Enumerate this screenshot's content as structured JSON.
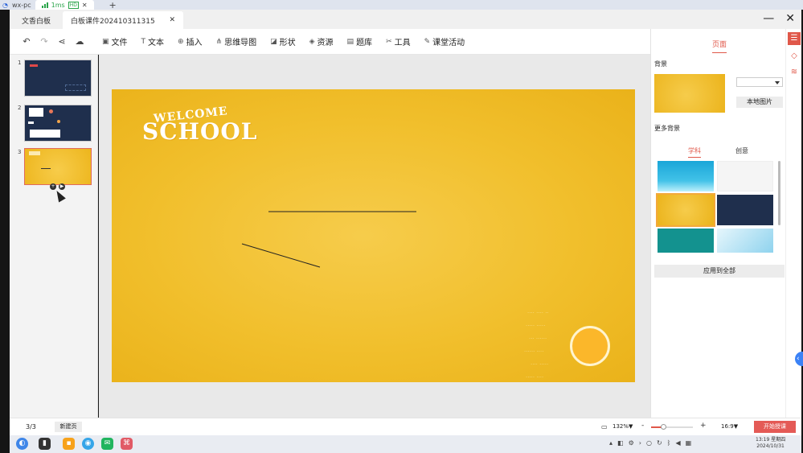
{
  "remote": {
    "device": "wx-pc",
    "latency": "1ms",
    "quality": "HD"
  },
  "app_tabs": [
    {
      "label": "文香白板",
      "active": false
    },
    {
      "label": "白板课件202410311315",
      "active": true
    }
  ],
  "toolbar": {
    "items": [
      {
        "label": "文件",
        "icon": "file-icon"
      },
      {
        "label": "文本",
        "icon": "text-icon"
      },
      {
        "label": "插入",
        "icon": "insert-icon"
      },
      {
        "label": "思维导图",
        "icon": "mindmap-icon"
      },
      {
        "label": "形状",
        "icon": "shape-icon"
      },
      {
        "label": "资源",
        "icon": "resource-icon"
      },
      {
        "label": "题库",
        "icon": "question-bank-icon"
      },
      {
        "label": "工具",
        "icon": "tools-icon"
      },
      {
        "label": "课堂活动",
        "icon": "class-activity-icon"
      }
    ]
  },
  "thumbnails": [
    {
      "num": "1"
    },
    {
      "num": "2"
    },
    {
      "num": "3"
    }
  ],
  "slide": {
    "welcome": "WELCOME",
    "school": "SCHOOL"
  },
  "right_panel": {
    "tab": "页面",
    "background_label": "背景",
    "local_image_button": "本地图片",
    "more_backgrounds_label": "更多背景",
    "sub_tabs": [
      {
        "label": "学科",
        "active": true
      },
      {
        "label": "创意",
        "active": false
      }
    ],
    "apply_all_button": "应用到全部"
  },
  "bottom": {
    "page_count": "3/3",
    "new_page_button": "新建页",
    "zoom": "132%▼",
    "zoom_percent": 132,
    "zoom_minus": "-",
    "zoom_plus": "+",
    "ratio": "16:9▼",
    "start_button": "开始授课"
  },
  "taskbar": {
    "time": "13:19 星期四",
    "date": "2024/10/31"
  },
  "colors": {
    "accent": "#e0584a",
    "slide_bg": "#f1bf2c",
    "thumb_dark": "#1f2f4d"
  }
}
